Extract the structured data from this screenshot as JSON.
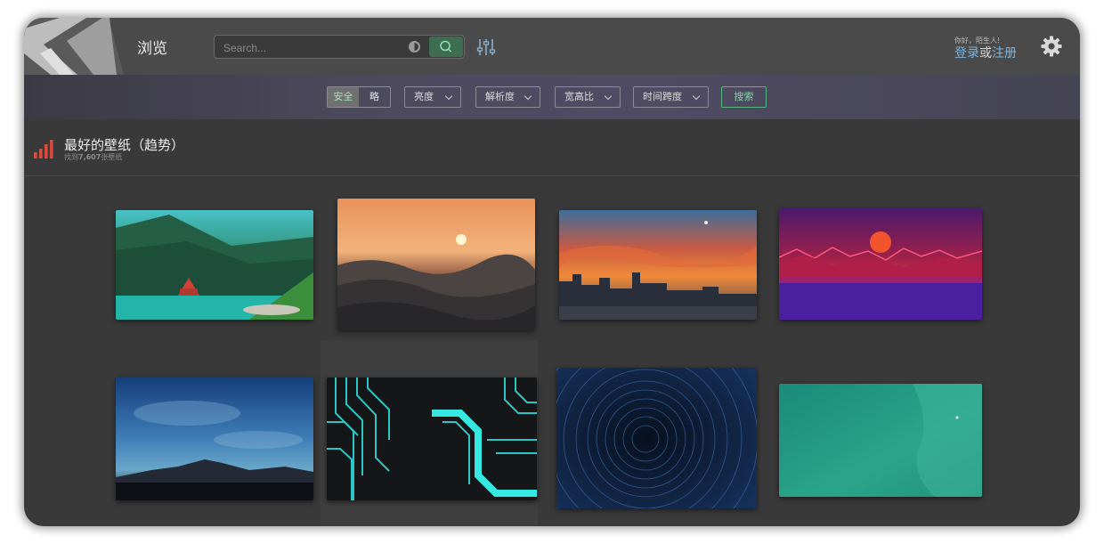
{
  "header": {
    "nav_title": "浏览",
    "search_placeholder": "Search...",
    "greeting": "你好，陌生人!",
    "auth_login": "登录",
    "auth_or": "或",
    "auth_register": "注册"
  },
  "filters": {
    "purity_safe": "安全",
    "purity_sketchy": "略",
    "brightness": "亮度",
    "resolution": "解析度",
    "ratio": "宽高比",
    "time_range": "时间跨度",
    "submit": "搜索"
  },
  "section": {
    "title": "最好的壁纸（趋势）",
    "subtitle_prefix": "找到",
    "subtitle_count": "7,607",
    "subtitle_suffix": "张壁纸"
  },
  "colors": {
    "accent_green": "#54b780",
    "link_blue": "#7cb4e0",
    "trend_red": "#d64b3a"
  },
  "wallpapers": [
    {
      "theme": "lake-house"
    },
    {
      "theme": "sunset-waves"
    },
    {
      "theme": "city-sunset"
    },
    {
      "theme": "synthwave-moon"
    },
    {
      "theme": "mountain-sky"
    },
    {
      "theme": "circuit-board"
    },
    {
      "theme": "star-trails"
    },
    {
      "theme": "aerial-ocean"
    }
  ]
}
